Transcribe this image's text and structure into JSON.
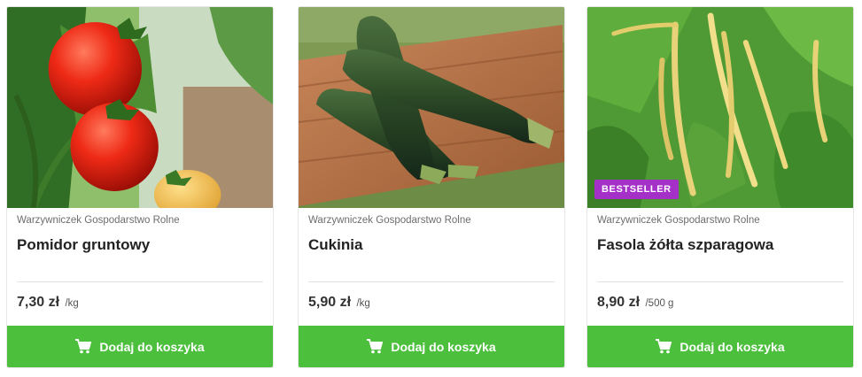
{
  "colors": {
    "button_green": "#4cbf3c",
    "badge_purple": "#a530c8"
  },
  "products": [
    {
      "image": "tomato-photo",
      "producer": "Warzywniczek Gospodarstwo Rolne",
      "name": "Pomidor gruntowy",
      "price": "7,30 zł",
      "unit": "/kg",
      "button_label": "Dodaj do koszyka",
      "button_icon": "cart-icon"
    },
    {
      "image": "zucchini-photo",
      "producer": "Warzywniczek Gospodarstwo Rolne",
      "name": "Cukinia",
      "price": "5,90 zł",
      "unit": "/kg",
      "button_label": "Dodaj do koszyka",
      "button_icon": "cart-icon"
    },
    {
      "image": "yellow-bean-photo",
      "badge": "BESTSELLER",
      "producer": "Warzywniczek Gospodarstwo Rolne",
      "name": "Fasola żółta szparagowa",
      "price": "8,90 zł",
      "unit": "/500 g",
      "button_label": "Dodaj do koszyka",
      "button_icon": "cart-icon"
    }
  ]
}
